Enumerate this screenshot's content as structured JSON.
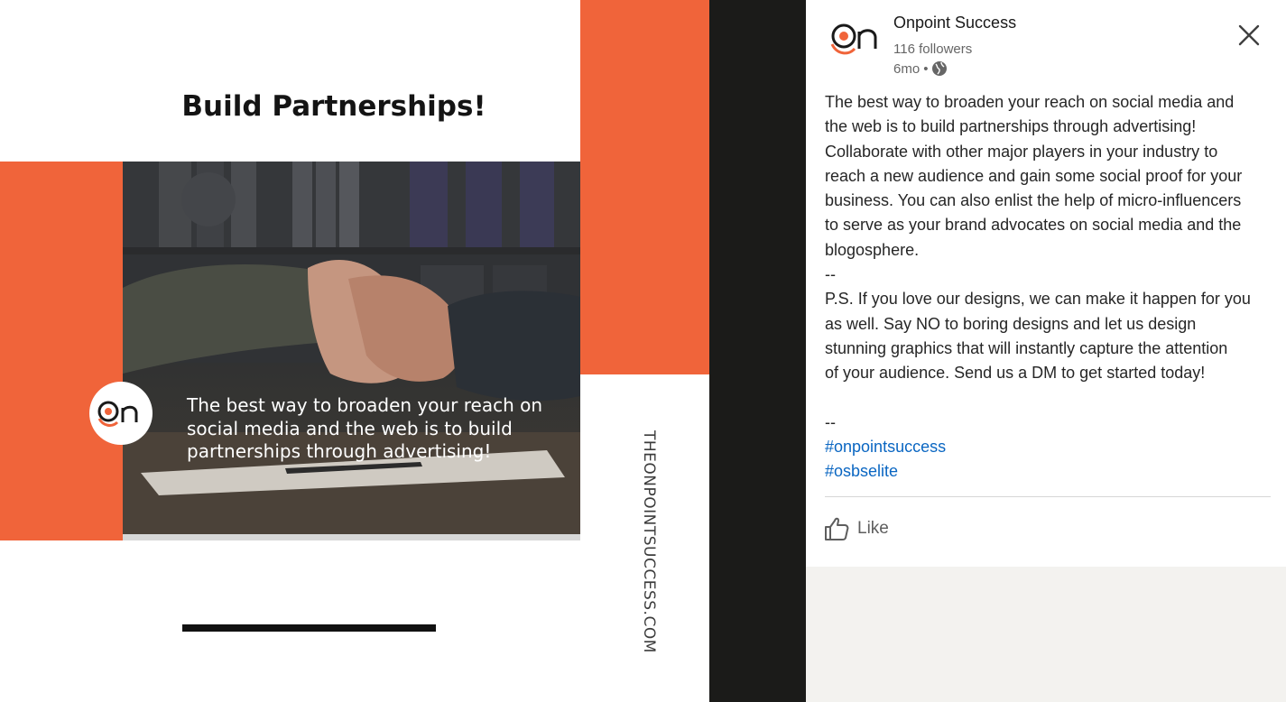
{
  "image": {
    "headline": "Build Partnerships!",
    "overlay_lines": [
      "The best way to broaden your reach on",
      "social media and the web is to build",
      "partnerships through advertising!"
    ],
    "vertical_url": "THEONPOINTSUCCESS.COM",
    "logo_text": "On"
  },
  "post": {
    "company_name": "Onpoint Success",
    "followers": "116 followers",
    "age": "6mo",
    "separator": "•",
    "visibility_icon": "globe-icon",
    "body_lines": [
      "The best way to broaden your reach on social media and",
      "the web is to build partnerships through advertising!",
      "Collaborate with other major players in your industry to",
      "reach a new audience and gain some social proof for your",
      "business. You can also enlist the help of micro-influencers",
      "to serve as your brand advocates on social media and the",
      "blogosphere.",
      "--",
      "P.S. If you love our designs, we can make it happen for you",
      "as well. Say NO to boring designs and let us design",
      "stunning graphics that will instantly capture the attention",
      "of your audience. Send us a DM to get started today!",
      "",
      "--"
    ],
    "hashtags": [
      "#onpointsuccess",
      "#osbselite"
    ],
    "like_label": "Like"
  },
  "colors": {
    "brand_orange": "#f0643a",
    "hashtag_blue": "#0a66c2",
    "dark_backdrop": "#1b1b19"
  }
}
